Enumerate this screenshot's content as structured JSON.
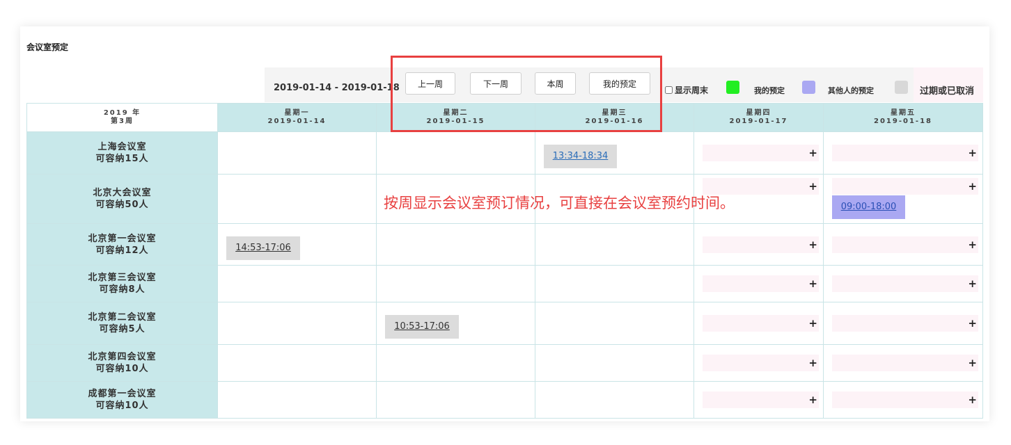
{
  "page": {
    "title": "会议室预定"
  },
  "toolbar": {
    "date_range": "2019-01-14 - 2019-01-18",
    "prev_week": "上一周",
    "next_week": "下一周",
    "this_week": "本周",
    "my_bookings": "我的预定",
    "show_weekend": "显示周末"
  },
  "legend": [
    {
      "label": "我的预定",
      "color": "#22ee22"
    },
    {
      "label": "其他人的预定",
      "color": "#aaa8f2"
    },
    {
      "label": "过期或已取消",
      "color": "#d8d8d8"
    }
  ],
  "header": {
    "year": "2019 年",
    "week": "第3周",
    "days": [
      {
        "name": "星期一",
        "date": "2019-01-14"
      },
      {
        "name": "星期二",
        "date": "2019-01-15"
      },
      {
        "name": "星期三",
        "date": "2019-01-16"
      },
      {
        "name": "星期四",
        "date": "2019-01-17"
      },
      {
        "name": "星期五",
        "date": "2019-01-18"
      }
    ]
  },
  "rooms": [
    {
      "name": "上海会议室",
      "capacity": "可容纳15人"
    },
    {
      "name": "北京大会议室",
      "capacity": "可容纳50人"
    },
    {
      "name": "北京第一会议室",
      "capacity": "可容纳12人"
    },
    {
      "name": "北京第三会议室",
      "capacity": "可容纳8人"
    },
    {
      "name": "北京第二会议室",
      "capacity": "可容纳5人"
    },
    {
      "name": "北京第四会议室",
      "capacity": "可容纳10人"
    },
    {
      "name": "成都第一会议室",
      "capacity": "可容纳10人"
    }
  ],
  "bookings": [
    {
      "room": 0,
      "day": 2,
      "time": "13:34-18:34",
      "status": "past-link"
    },
    {
      "room": 1,
      "day": 4,
      "time": "09:00-18:00",
      "status": "other"
    },
    {
      "room": 2,
      "day": 0,
      "time": "14:53-17:06",
      "status": "past"
    },
    {
      "room": 4,
      "day": 1,
      "time": "10:53-17:06",
      "status": "past"
    }
  ],
  "slot_plus": "+",
  "annotation": "按周显示会议室预订情况，可直接在会议室预约时间。"
}
